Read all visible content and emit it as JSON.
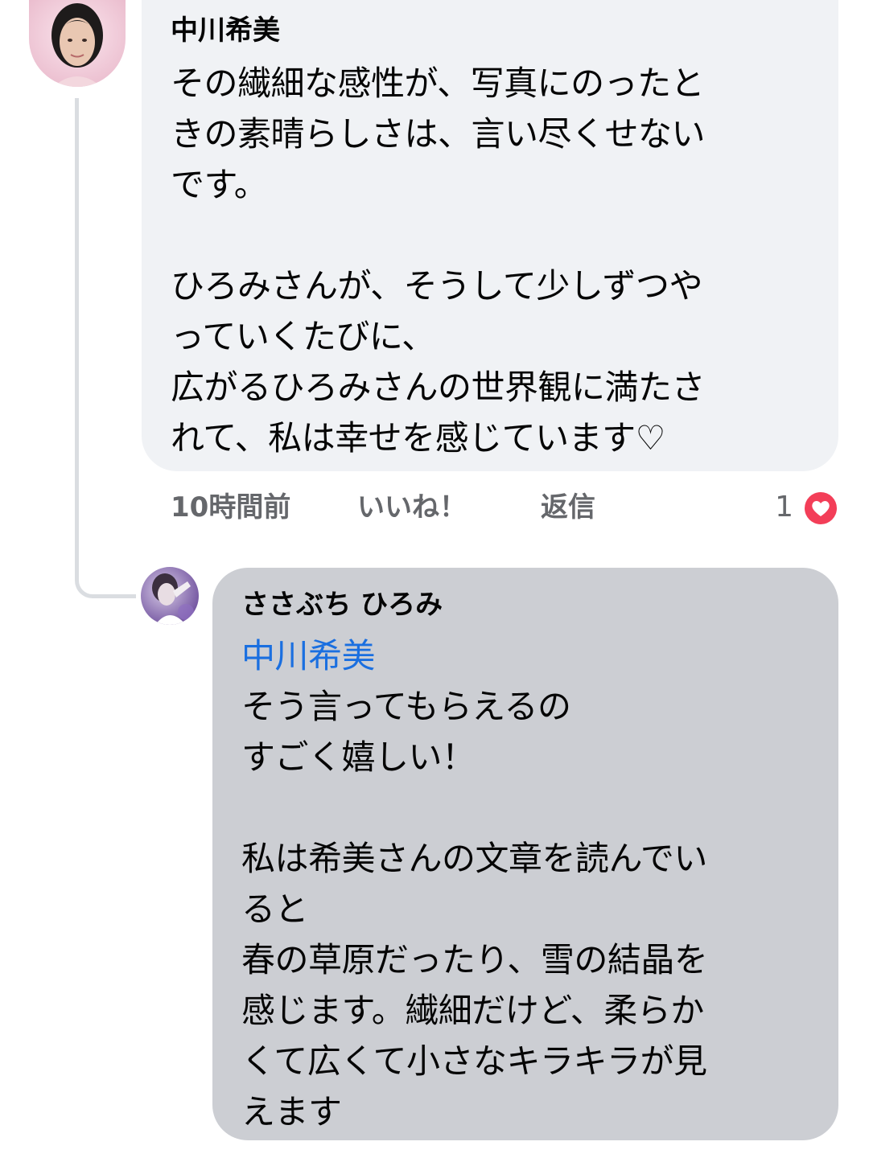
{
  "comment": {
    "author": "中川希美",
    "text": "その繊細な感性が、写真にのったと\nきの素晴らしさは、言い尽くせない\nです。\n\nひろみさんが、そうして少しずつや\nっていくたびに、\n広がるひろみさんの世界観に満たさ\nれて、私は幸せを感じています♡",
    "time": "10時間前",
    "like_label": "いいね！",
    "reply_label": "返信",
    "reaction_count": "1",
    "reaction_icon": "heart-icon",
    "reaction_color": "#f33e58"
  },
  "reply": {
    "author": "ささぶち ひろみ",
    "mention": "中川希美",
    "text": "そう言ってもらえるの\nすごく嬉しい！\n\n私は希美さんの文章を読んでい\nると\n春の草原だったり、雪の結晶を\n感じます。繊細だけど、柔らか\nくて広くて小さなキラキラが見\nえます"
  },
  "colors": {
    "comment_bubble": "#f0f2f5",
    "reply_bubble": "#ccced3",
    "mention": "#1a6fe0",
    "meta_text": "#65676b",
    "thread_line": "#dadde1"
  }
}
